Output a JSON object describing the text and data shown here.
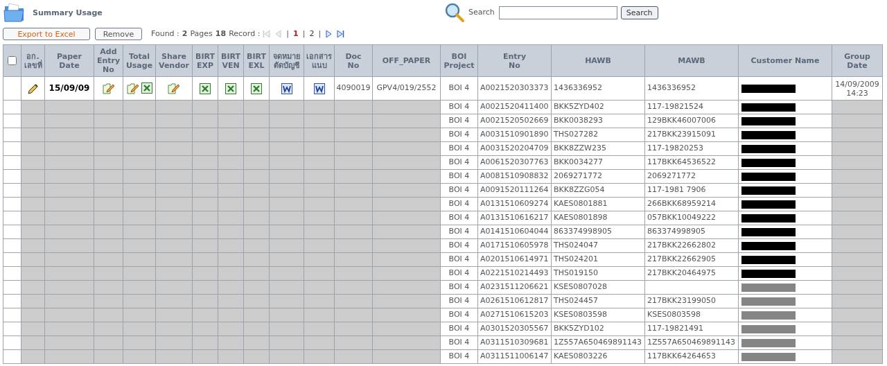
{
  "page": {
    "title": "Summary Usage"
  },
  "search": {
    "label": "Search",
    "button": "Search"
  },
  "toolbar": {
    "buttons": [
      {
        "label": "Export to Excel",
        "kind": "primary"
      },
      {
        "label": "Remove",
        "kind": "plain"
      }
    ],
    "paging": {
      "found_label": "Found :",
      "pages": "2",
      "pages_label": "Pages",
      "records": "18",
      "records_label": "Record :",
      "first_disabled": true,
      "prev_disabled": true,
      "separators": [
        "|",
        "|",
        "|"
      ],
      "page_links": [
        {
          "label": "1",
          "selected": true
        },
        {
          "label": "2",
          "selected": false
        }
      ]
    }
  },
  "table": {
    "select_all": {
      "checked": false
    },
    "columns": [
      {
        "lines": [
          "อก.",
          "เลขที่"
        ]
      },
      {
        "lines": [
          "Paper",
          "Date"
        ]
      },
      {
        "lines": [
          "Add",
          "Entry",
          "No"
        ]
      },
      {
        "lines": [
          "Total",
          "Usage"
        ]
      },
      {
        "lines": [
          "Share",
          "Vendor"
        ]
      },
      {
        "lines": [
          "BIRT",
          "EXP"
        ]
      },
      {
        "lines": [
          "BIRT",
          "VEN"
        ]
      },
      {
        "lines": [
          "BIRT",
          "EXL"
        ]
      },
      {
        "lines": [
          "จดหมาย",
          "ตัดบัญชี"
        ]
      },
      {
        "lines": [
          "เอกสาร",
          "แนบ"
        ]
      },
      {
        "lines": [
          "Doc",
          "No"
        ]
      },
      {
        "lines": [
          "OFF_PAPER"
        ]
      },
      {
        "lines": [
          "BOI",
          "Project"
        ]
      },
      {
        "lines": [
          "Entry",
          "No"
        ]
      },
      {
        "lines": [
          "HAWB"
        ]
      },
      {
        "lines": [
          "MAWB"
        ]
      },
      {
        "lines": [
          "Customer Name"
        ]
      },
      {
        "lines": [
          "Group",
          "Date"
        ]
      }
    ],
    "rows": [
      {
        "kind": "full",
        "paper_date": "15/09/09",
        "doc_no": "4090019",
        "off_paper": "GPV4/019/2552",
        "boi_project": "BOI 4",
        "entry_no": "A0021520303373",
        "hawb": "1436336952",
        "mawb": "1436336952",
        "customer_redaction": {
          "color": "#000000"
        },
        "group_date": "14/09/2009 14:23"
      },
      {
        "kind": "summary",
        "boi_project": "BOI 4",
        "entry_no": "A0021520411400",
        "hawb": "BKK5ZYD402",
        "mawb": "117-19821524",
        "customer_redaction": {
          "color": "#000000"
        }
      },
      {
        "kind": "summary",
        "boi_project": "BOI 4",
        "entry_no": "A0021520502669",
        "hawb": "BKK0038293",
        "mawb": "129BKK46007006",
        "customer_redaction": {
          "color": "#000000"
        }
      },
      {
        "kind": "summary",
        "boi_project": "BOI 4",
        "entry_no": "A0031510901890",
        "hawb": "THS027282",
        "mawb": "217BKK23915091",
        "customer_redaction": {
          "color": "#000000"
        }
      },
      {
        "kind": "summary",
        "boi_project": "BOI 4",
        "entry_no": "A0031520204709",
        "hawb": "BKK8ZZW235",
        "mawb": "117-19820253",
        "customer_redaction": {
          "color": "#000000"
        }
      },
      {
        "kind": "summary",
        "boi_project": "BOI 4",
        "entry_no": "A0061520307763",
        "hawb": "BKK0034277",
        "mawb": "117BKK64536522",
        "customer_redaction": {
          "color": "#000000"
        }
      },
      {
        "kind": "summary",
        "boi_project": "BOI 4",
        "entry_no": "A0081510908832",
        "hawb": "2069271772",
        "mawb": "2069271772",
        "customer_redaction": {
          "color": "#000000"
        }
      },
      {
        "kind": "summary",
        "boi_project": "BOI 4",
        "entry_no": "A0091520111264",
        "hawb": "BKK8ZZG054",
        "mawb": "117-1981 7906",
        "customer_redaction": {
          "color": "#000000"
        }
      },
      {
        "kind": "summary",
        "boi_project": "BOI 4",
        "entry_no": "A0131510609274",
        "hawb": "KAES0801881",
        "mawb": "266BKK68959214",
        "customer_redaction": {
          "color": "#000000"
        }
      },
      {
        "kind": "summary",
        "boi_project": "BOI 4",
        "entry_no": "A0131510616217",
        "hawb": "KAES0801898",
        "mawb": "057BKK10049222",
        "customer_redaction": {
          "color": "#000000"
        }
      },
      {
        "kind": "summary",
        "boi_project": "BOI 4",
        "entry_no": "A0141510604044",
        "hawb": "863374998905",
        "mawb": "863374998905",
        "customer_redaction": {
          "color": "#000000"
        }
      },
      {
        "kind": "summary",
        "boi_project": "BOI 4",
        "entry_no": "A0171510605978",
        "hawb": "THS024047",
        "mawb": "217BKK22662802",
        "customer_redaction": {
          "color": "#000000"
        }
      },
      {
        "kind": "summary",
        "boi_project": "BOI 4",
        "entry_no": "A0201510614971",
        "hawb": "THS024201",
        "mawb": "217BKK22662905",
        "customer_redaction": {
          "color": "#000000"
        }
      },
      {
        "kind": "summary",
        "boi_project": "BOI 4",
        "entry_no": "A0221510214493",
        "hawb": "THS019150",
        "mawb": "217BKK20464975",
        "customer_redaction": {
          "color": "#000000"
        }
      },
      {
        "kind": "summary",
        "boi_project": "BOI 4",
        "entry_no": "A0231511206621",
        "hawb": "KSES0807028",
        "customer_redaction": {
          "color": "#858585"
        }
      },
      {
        "kind": "summary",
        "boi_project": "BOI 4",
        "entry_no": "A0261510612817",
        "hawb": "THS024457",
        "mawb": "217BKK23199050",
        "customer_redaction": {
          "color": "#858585"
        }
      },
      {
        "kind": "summary",
        "boi_project": "BOI 4",
        "entry_no": "A0271510615203",
        "hawb": "KSES0803598",
        "mawb": "KSES0803598",
        "customer_redaction": {
          "color": "#858585"
        }
      },
      {
        "kind": "summary",
        "boi_project": "BOI 4",
        "entry_no": "A0301520305567",
        "hawb": "BKK5ZYD102",
        "mawb": "117-19821491",
        "customer_redaction": {
          "color": "#858585"
        }
      },
      {
        "kind": "summary",
        "boi_project": "BOI 4",
        "entry_no": "A0311510309681",
        "hawb": "1Z557A650469891143",
        "mawb": "1Z557A650469891143",
        "customer_redaction": {
          "color": "#858585"
        }
      },
      {
        "kind": "summary",
        "boi_project": "BOI 4",
        "entry_no": "A0311511006147",
        "hawb": "KAES0803226",
        "mawb": "117BKK64264653",
        "customer_redaction": {
          "color": "#858585"
        }
      }
    ]
  }
}
